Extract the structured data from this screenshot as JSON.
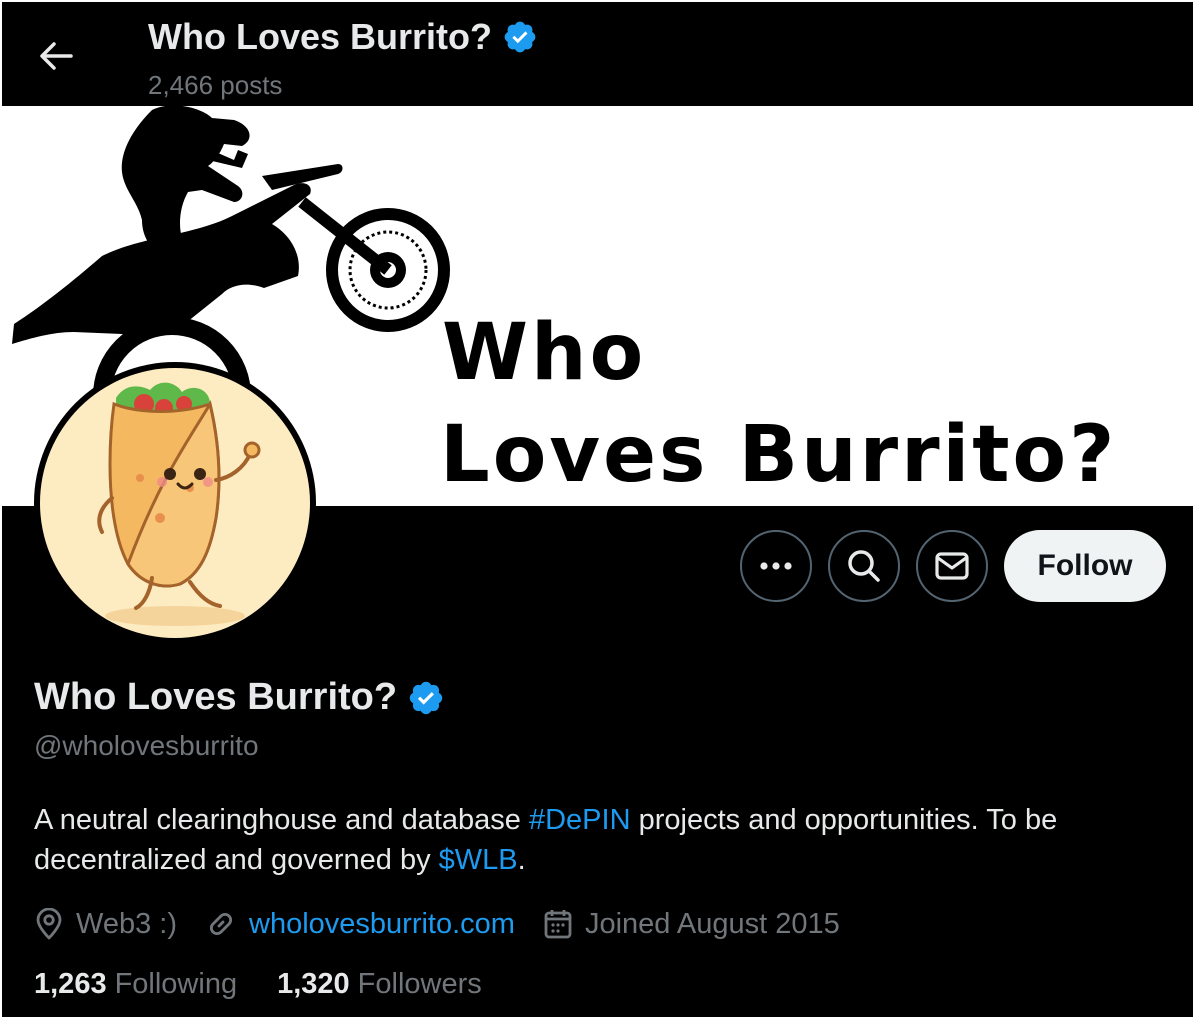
{
  "header": {
    "title": "Who Loves Burrito?",
    "posts_count": "2,466 posts"
  },
  "banner": {
    "line1": "Who",
    "line2": "Loves Burrito?"
  },
  "actions": {
    "more_icon": "more-dots-icon",
    "search_icon": "search-icon",
    "message_icon": "envelope-icon",
    "follow_label": "Follow"
  },
  "profile": {
    "name": "Who Loves Burrito?",
    "handle": "@wholovesburrito",
    "bio_part1": "A neutral clearinghouse and database ",
    "bio_hashtag": "#DePIN",
    "bio_part2": " projects and opportunities. To be decentralized and governed by ",
    "bio_cashtag": "$WLB",
    "bio_part3": ".",
    "location": "Web3 :)",
    "website": "wholovesburrito.com",
    "joined": "Joined August 2015",
    "following_count": "1,263",
    "following_label": "Following",
    "followers_count": "1,320",
    "followers_label": "Followers"
  },
  "colors": {
    "background": "#000000",
    "primary_text": "#e7e9ea",
    "secondary_text": "#71767b",
    "link": "#1d9bf0",
    "verified": "#1d9bf0",
    "follow_button_bg": "#eff3f4"
  }
}
